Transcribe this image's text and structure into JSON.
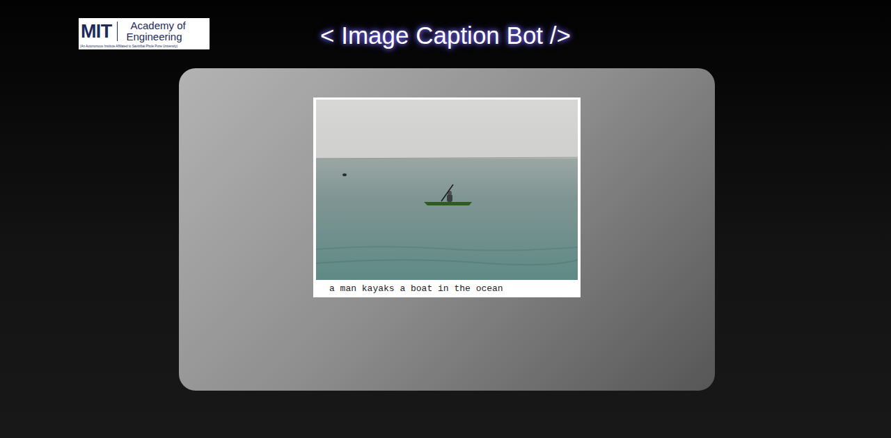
{
  "logo": {
    "mark": "MIT",
    "line1": "Academy of",
    "line2": "Engineering",
    "subtitle": "(An Autonomous Institute Affiliated to Savitribai Phule Pune University)"
  },
  "title": "< Image Caption Bot />",
  "result": {
    "caption": "a man kayaks a boat in the ocean"
  }
}
